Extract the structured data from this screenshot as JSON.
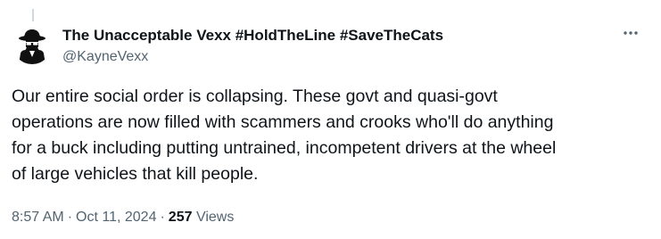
{
  "author": {
    "display_name": "The Unacceptable Vexx #HoldTheLine #SaveTheCats",
    "handle": "@KayneVexx",
    "avatar_icon": "spy-silhouette-icon"
  },
  "more_icon": "more-dots-icon",
  "tweet": {
    "text": "Our entire social order is collapsing. These govt and quasi-govt\noperations are now filled with scammers and crooks who'll do anything\nfor a buck including putting untrained, incompetent drivers at the wheel\nof large vehicles that kill people."
  },
  "meta": {
    "time": "8:57 AM",
    "separator_1": "·",
    "date": "Oct 11, 2024",
    "separator_2": "·",
    "views_count": "257",
    "views_label": "Views"
  },
  "colors": {
    "text_primary": "#0f1419",
    "text_secondary": "#536471",
    "thread_line": "#cfd9de"
  }
}
